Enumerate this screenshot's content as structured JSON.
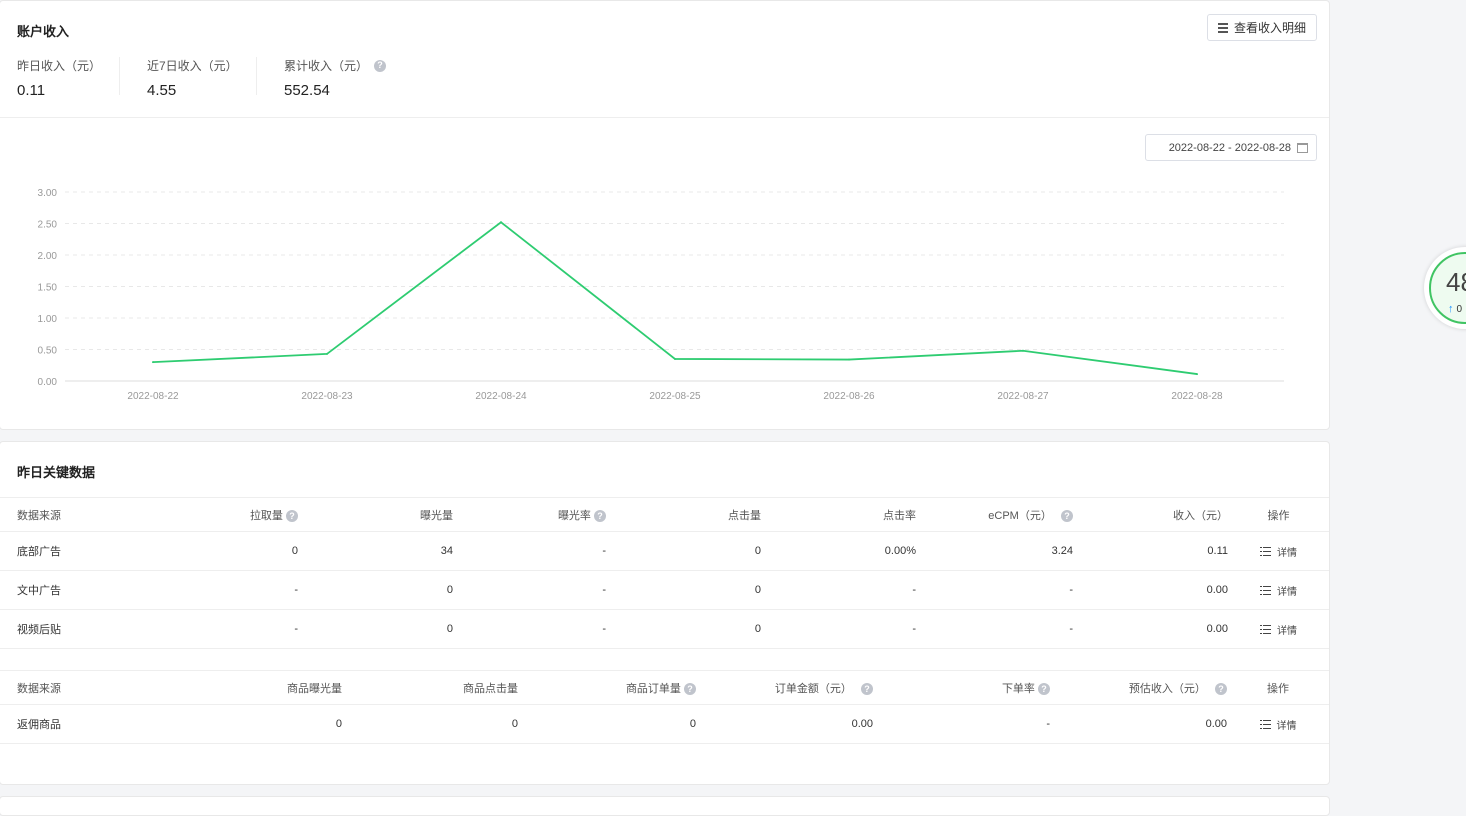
{
  "income": {
    "title": "账户收入",
    "detail_button": "查看收入明细",
    "stats": [
      {
        "label": "昨日收入（元）",
        "value": "0.11"
      },
      {
        "label": "近7日收入（元）",
        "value": "4.55"
      },
      {
        "label": "累计收入（元）",
        "value": "552.54"
      }
    ],
    "date_range": "2022-08-22 - 2022-08-28"
  },
  "chart_data": {
    "type": "line",
    "x": [
      "2022-08-22",
      "2022-08-23",
      "2022-08-24",
      "2022-08-25",
      "2022-08-26",
      "2022-08-27",
      "2022-08-28"
    ],
    "y_ticks": [
      "0.00",
      "0.50",
      "1.00",
      "1.50",
      "2.00",
      "2.50",
      "3.00"
    ],
    "ylim": [
      0,
      3
    ],
    "series": [
      {
        "values": [
          0.3,
          0.43,
          2.52,
          0.35,
          0.34,
          0.48,
          0.11
        ],
        "color": "#2ecc71"
      }
    ],
    "grid": true
  },
  "key": {
    "title": "昨日关键数据",
    "table1": {
      "headers": [
        "数据来源",
        "拉取量",
        "曝光量",
        "曝光率",
        "点击量",
        "点击率",
        "eCPM（元）",
        "收入（元）",
        "操作"
      ],
      "rows": [
        [
          "底部广告",
          "0",
          "34",
          "-",
          "0",
          "0.00%",
          "3.24",
          "0.11",
          "详情"
        ],
        [
          "文中广告",
          "-",
          "0",
          "-",
          "0",
          "-",
          "-",
          "0.00",
          "详情"
        ],
        [
          "视频后贴",
          "-",
          "0",
          "-",
          "0",
          "-",
          "-",
          "0.00",
          "详情"
        ]
      ]
    },
    "table2": {
      "headers": [
        "数据来源",
        "商品曝光量",
        "商品点击量",
        "商品订单量",
        "订单金额（元）",
        "下单率",
        "预估收入（元）",
        "操作"
      ],
      "rows": [
        [
          "返佣商品",
          "0",
          "0",
          "0",
          "0.00",
          "-",
          "0.00",
          "详情"
        ]
      ]
    }
  },
  "help_glyph": "?",
  "widget": {
    "number": "48",
    "sub": "0"
  },
  "colors": {
    "line": "#2ecc71",
    "accent": "#1890ff"
  }
}
